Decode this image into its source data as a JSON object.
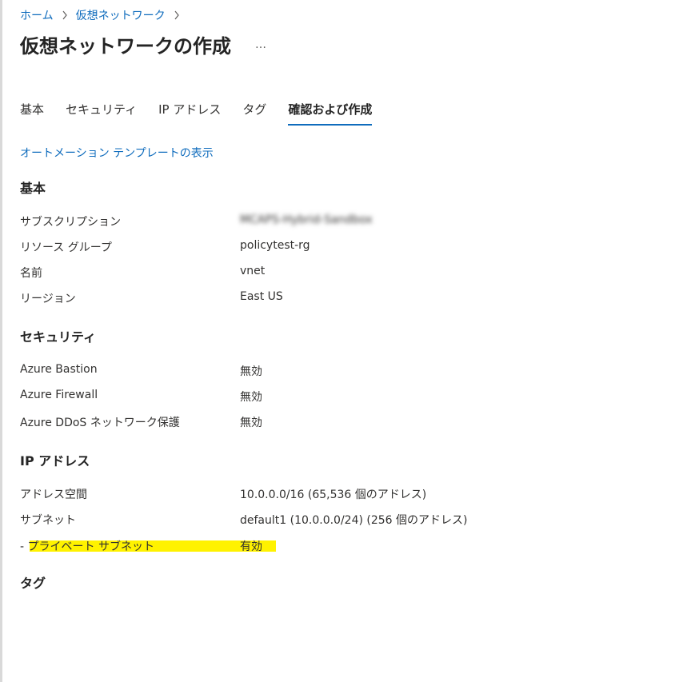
{
  "breadcrumb": {
    "items": [
      "ホーム",
      "仮想ネットワーク"
    ]
  },
  "page": {
    "title": "仮想ネットワークの作成",
    "more": "…"
  },
  "tabs": [
    {
      "label": "基本",
      "active": false
    },
    {
      "label": "セキュリティ",
      "active": false
    },
    {
      "label": "IP アドレス",
      "active": false
    },
    {
      "label": "タグ",
      "active": false
    },
    {
      "label": "確認および作成",
      "active": true
    }
  ],
  "template_link": "オートメーション テンプレートの表示",
  "sections": {
    "basics": {
      "title": "基本",
      "rows": [
        {
          "label": "サブスクリプション",
          "value": "MCAPS-Hybrid-Sandbox"
        },
        {
          "label": "リソース グループ",
          "value": "policytest-rg"
        },
        {
          "label": "名前",
          "value": "vnet"
        },
        {
          "label": "リージョン",
          "value": "East US"
        }
      ]
    },
    "security": {
      "title": "セキュリティ",
      "rows": [
        {
          "label": "Azure Bastion",
          "value": "無効"
        },
        {
          "label": "Azure Firewall",
          "value": "無効"
        },
        {
          "label": "Azure DDoS ネットワーク保護",
          "value": "無効"
        }
      ]
    },
    "ip": {
      "title": "IP アドレス",
      "rows": [
        {
          "label": "アドレス空間",
          "value": "10.0.0.0/16 (65,536 個のアドレス)"
        },
        {
          "label": "サブネット",
          "value": "default1 (10.0.0.0/24) (256 個のアドレス)"
        },
        {
          "label": "- プライベート サブネット",
          "value": "有効"
        }
      ]
    },
    "tags": {
      "title": "タグ"
    }
  },
  "colors": {
    "link": "#0f6cbd",
    "highlight": "#fff200",
    "text": "#323130"
  }
}
